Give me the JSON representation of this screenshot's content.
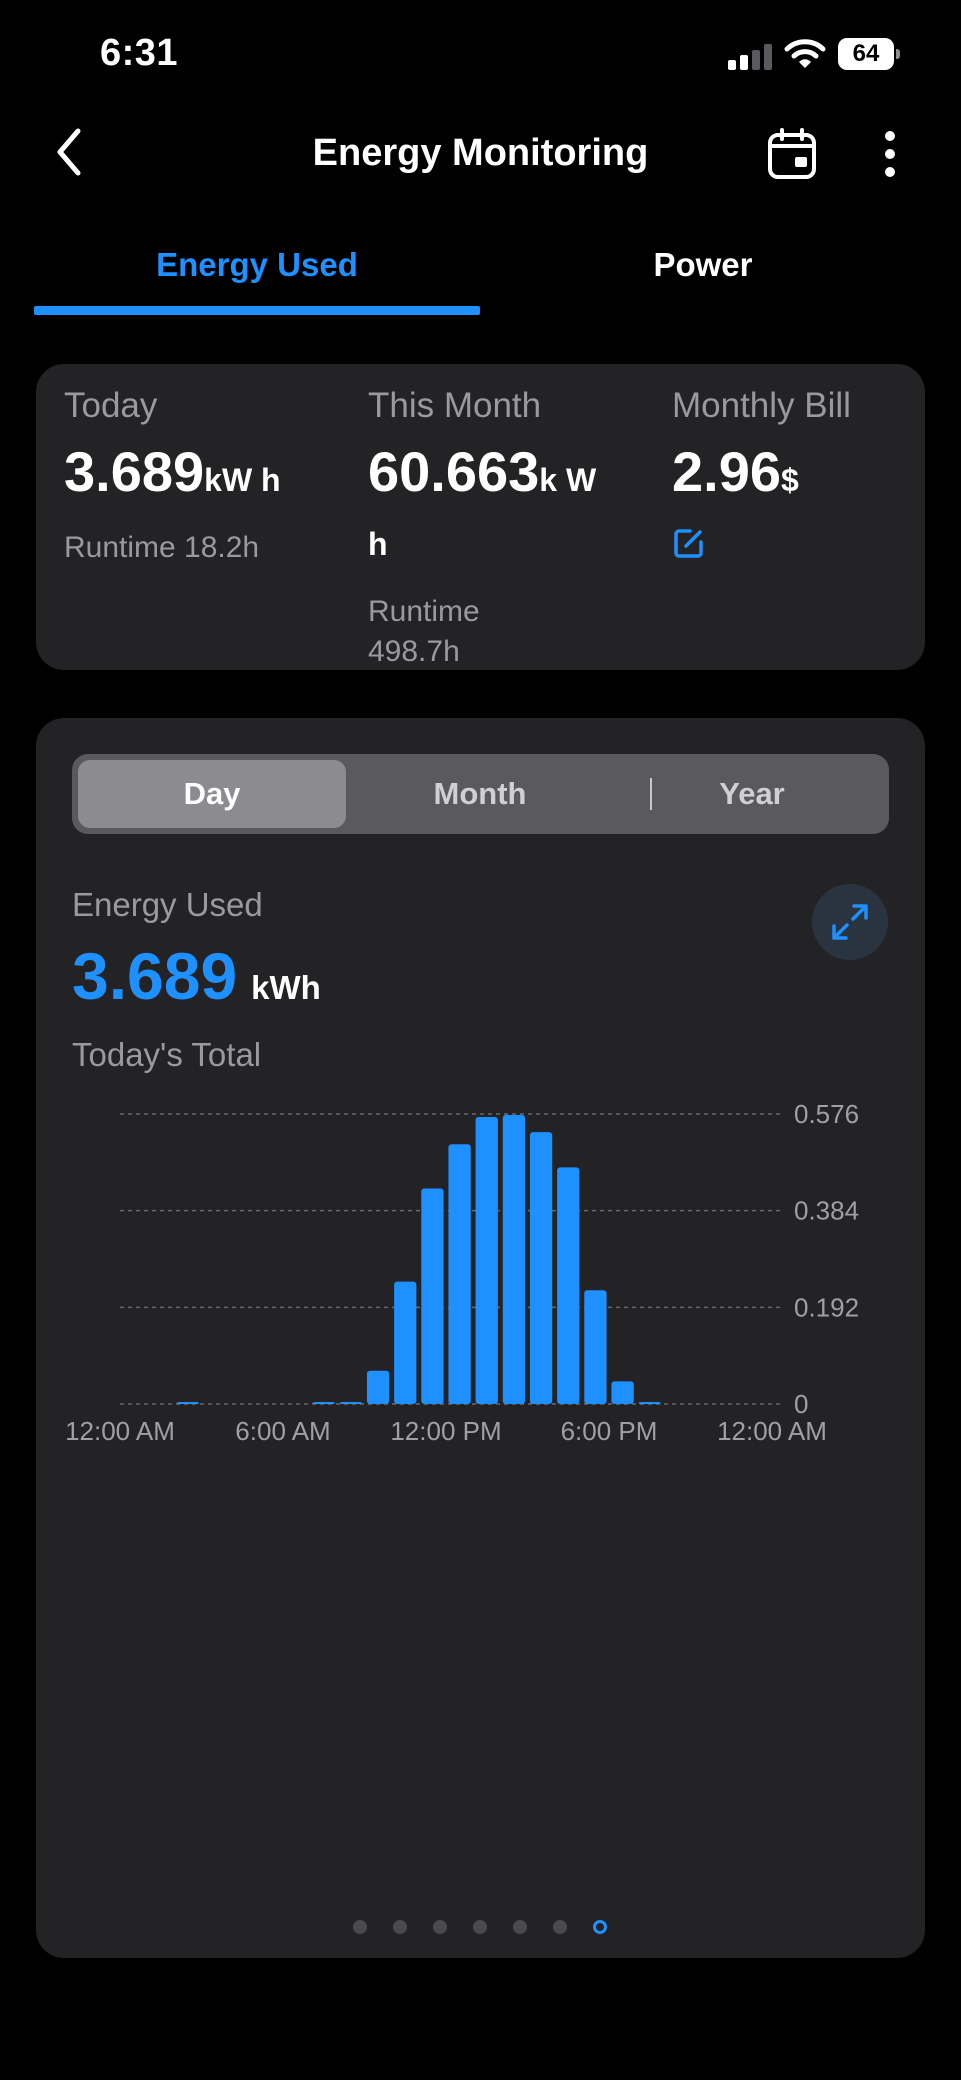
{
  "status_bar": {
    "time": "6:31",
    "battery": "64"
  },
  "nav": {
    "title": "Energy Monitoring"
  },
  "tabs": [
    {
      "label": "Energy Used",
      "active": true
    },
    {
      "label": "Power",
      "active": false
    }
  ],
  "summary": {
    "today": {
      "label": "Today",
      "value": "3.689",
      "unit": "kW h",
      "sub": "Runtime 18.2h"
    },
    "month": {
      "label": "This Month",
      "value": "60.663",
      "unit": "k Wh",
      "sub": "Runtime 498.7h"
    },
    "bill": {
      "label": "Monthly Bill",
      "value": "2.96",
      "unit": "$"
    }
  },
  "segmented": {
    "day": "Day",
    "month": "Month",
    "year": "Year",
    "selected": "Day"
  },
  "energy": {
    "label": "Energy Used",
    "value": "3.689",
    "unit": "kWh",
    "sub": "Today's Total"
  },
  "colors": {
    "accent": "#1e90ff",
    "card": "#232325",
    "background": "#000000"
  },
  "chart_data": {
    "type": "bar",
    "x": [
      0,
      1,
      2,
      3,
      4,
      5,
      6,
      7,
      8,
      9,
      10,
      11,
      12,
      13,
      14,
      15,
      16,
      17,
      18,
      19,
      20,
      21,
      22,
      23
    ],
    "values": [
      0,
      0,
      0.001,
      0,
      0,
      0,
      0,
      0.001,
      0.002,
      0.066,
      0.243,
      0.428,
      0.516,
      0.57,
      0.574,
      0.54,
      0.47,
      0.226,
      0.045,
      0.003,
      0,
      0,
      0,
      0
    ],
    "yticks": [
      "0",
      "0.192",
      "0.384",
      "0.576"
    ],
    "ytick_values": [
      0,
      0.192,
      0.384,
      0.576
    ],
    "ylim": [
      0,
      0.576
    ],
    "xticks": [
      "12:00 AM",
      "6:00 AM",
      "12:00 PM",
      "6:00 PM",
      "12:00 AM"
    ],
    "xtick_positions": [
      0,
      6,
      12,
      18,
      24
    ],
    "grid": true,
    "color": "#1e90ff"
  },
  "pager": {
    "count": 7,
    "active": 6
  }
}
